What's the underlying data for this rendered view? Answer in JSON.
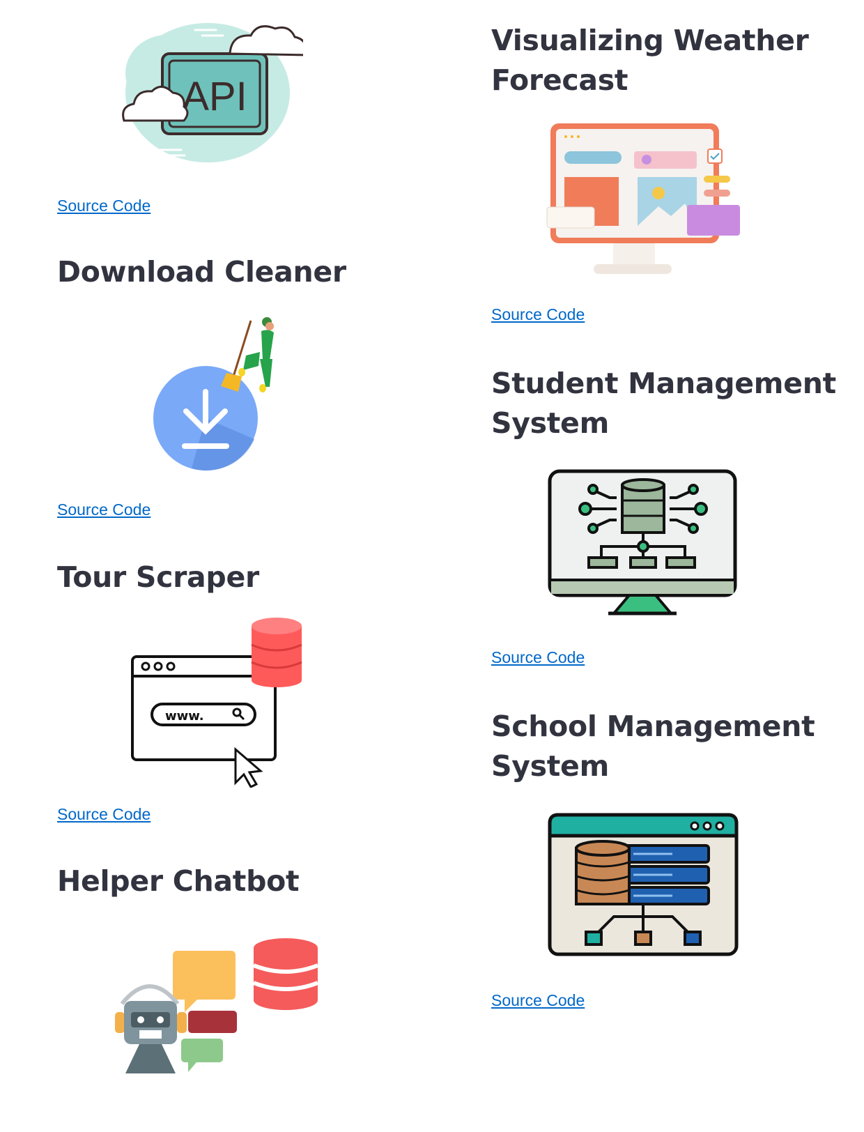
{
  "left_column": {
    "api_card": {
      "link": "Source Code",
      "image_text": "API"
    },
    "download_cleaner": {
      "title": "Download Cleaner",
      "link": "Source Code"
    },
    "tour_scraper": {
      "title": "Tour Scraper",
      "link": "Source Code",
      "image_text": "www."
    },
    "helper_chatbot": {
      "title": "Helper Chatbot"
    }
  },
  "right_column": {
    "weather": {
      "title_line1": "Visualizing Weather",
      "title_line2": "Forecast",
      "link": "Source Code"
    },
    "student": {
      "title_line1": "Student Management",
      "title_line2": "System",
      "link": "Source Code"
    },
    "school": {
      "title_line1": "School Management",
      "title_line2": "System",
      "link": "Source Code"
    }
  },
  "colors": {
    "heading": "#31333f",
    "link": "#0068c9",
    "background": "#ffffff"
  }
}
